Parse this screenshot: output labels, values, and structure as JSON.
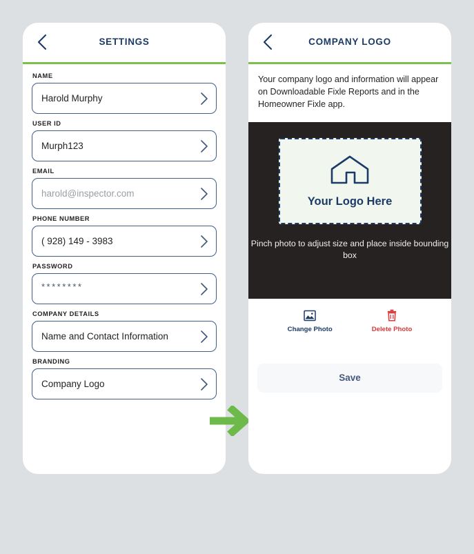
{
  "theme": {
    "page_bg": "#dde0e3",
    "accent_green": "#7cc04a",
    "navy": "#1b3a66",
    "border_blue": "#3f5e8c",
    "danger_red": "#d8393c",
    "photo_bg": "#262222",
    "logo_box_bg": "#f1f6ee"
  },
  "settings_screen": {
    "back_icon": "chevron-left-icon",
    "title": "SETTINGS",
    "fields": [
      {
        "label": "NAME",
        "value": "Harold Murphy",
        "is_placeholder": false,
        "chevron": "chevron-right-icon"
      },
      {
        "label": "USER ID",
        "value": "Murph123",
        "is_placeholder": false,
        "chevron": "chevron-right-icon"
      },
      {
        "label": "EMAIL",
        "value": "harold@inspector.com",
        "is_placeholder": true,
        "chevron": "chevron-right-icon"
      },
      {
        "label": "PHONE NUMBER",
        "value": "( 928) 149 - 3983",
        "is_placeholder": false,
        "chevron": "chevron-right-icon"
      },
      {
        "label": "PASSWORD",
        "value": "********",
        "is_placeholder": false,
        "chevron": "chevron-right-icon"
      },
      {
        "label": "COMPANY DETAILS",
        "value": "Name and Contact Information",
        "is_placeholder": false,
        "chevron": "chevron-right-icon"
      },
      {
        "label": "BRANDING",
        "value": "Company Logo",
        "is_placeholder": false,
        "chevron": "chevron-right-icon"
      }
    ]
  },
  "flow": {
    "arrow_icon": "green-right-arrow-icon"
  },
  "logo_screen": {
    "back_icon": "chevron-left-icon",
    "title": "COMPANY LOGO",
    "intro": "Your company logo and information will appear on Downloadable Fixle Reports and in the Homeowner Fixle app.",
    "logo_placeholder": {
      "icon": "house-icon",
      "text": "Your Logo Here"
    },
    "pinch_hint": "Pinch photo to adjust size and place inside bounding box",
    "actions": [
      {
        "icon": "image-icon",
        "label": "Change Photo"
      },
      {
        "icon": "trash-icon",
        "label": "Delete Photo"
      }
    ],
    "save_label": "Save"
  }
}
